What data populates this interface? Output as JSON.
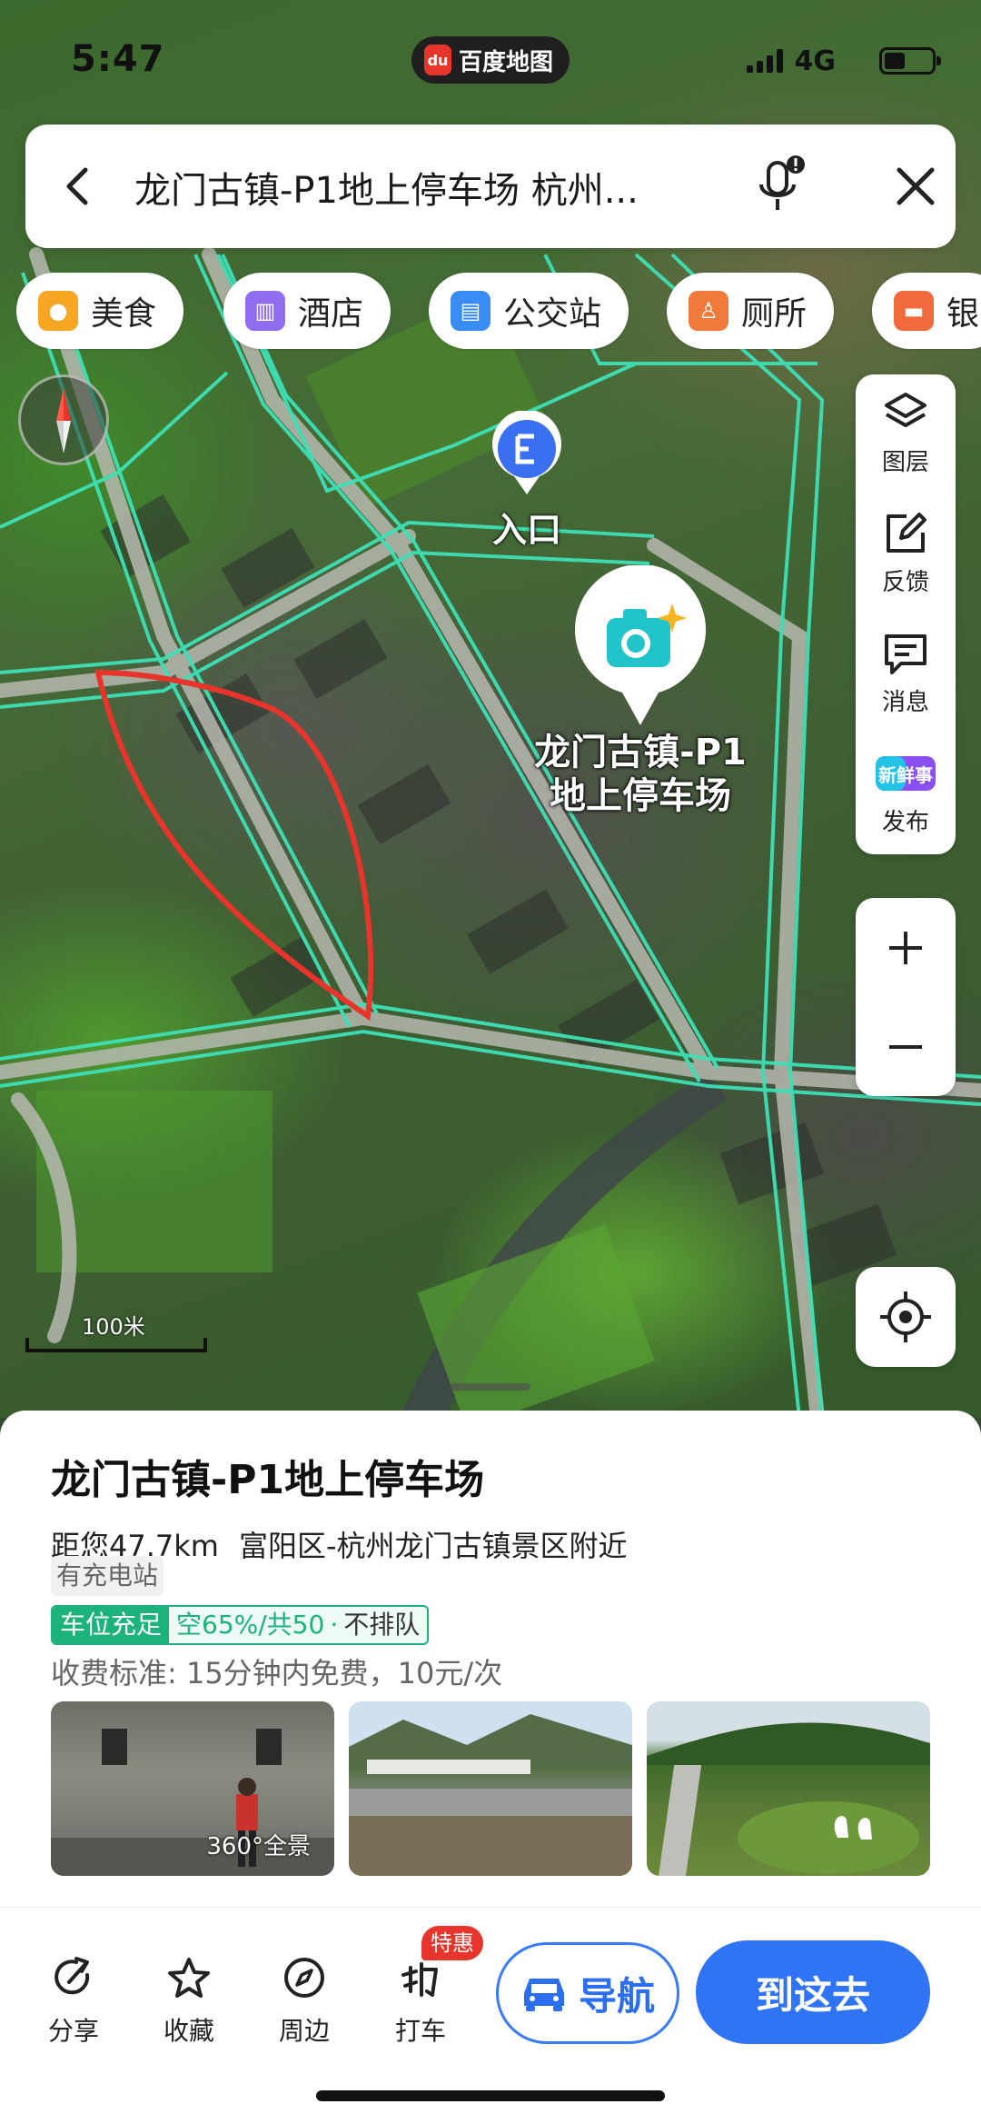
{
  "status_bar": {
    "time": "5:47",
    "app_logo": "百度地图",
    "network": "4G"
  },
  "search": {
    "query": "龙门古镇-P1地上停车场 杭州..."
  },
  "categories": [
    {
      "label": "美食",
      "icon": "food-icon",
      "color": "#f6a623"
    },
    {
      "label": "酒店",
      "icon": "hotel-icon",
      "color": "#8f6cf0"
    },
    {
      "label": "公交站",
      "icon": "bus-stop-icon",
      "color": "#3a8cf5"
    },
    {
      "label": "厕所",
      "icon": "toilet-icon",
      "color": "#f07a3c"
    },
    {
      "label": "银",
      "icon": "bank-icon",
      "color": "#f06a3c"
    }
  ],
  "tools": [
    {
      "label": "图层",
      "icon": "layers-icon"
    },
    {
      "label": "反馈",
      "icon": "feedback-icon"
    },
    {
      "label": "消息",
      "icon": "message-icon"
    },
    {
      "label": "发布",
      "icon": "xinxianshi-icon",
      "sub": "新鲜事"
    }
  ],
  "map": {
    "entrance_label": "入口",
    "place_label_line1": "龙门古镇-P1",
    "place_label_line2": "地上停车场",
    "scale": "100米"
  },
  "place": {
    "title": "龙门古镇-P1地上停车场",
    "distance": "距您47.7km",
    "address": "富阳区-杭州龙门古镇景区附近",
    "tag": "有充电站",
    "parking_status": "车位充足",
    "parking_detail": "空65%/共50",
    "queue": "不排队",
    "fee": "收费标准: 15分钟内免费，10元/次",
    "photo_360_label": "360°全景"
  },
  "actions": [
    {
      "label": "分享",
      "icon": "share-icon"
    },
    {
      "label": "收藏",
      "icon": "star-icon"
    },
    {
      "label": "周边",
      "icon": "compass-icon"
    },
    {
      "label": "打车",
      "icon": "taxi-icon"
    }
  ],
  "taxi_badge": "特惠",
  "nav_button": "导航",
  "go_button": "到这去",
  "colors": {
    "accent": "#2f74f4",
    "road": "#3fe0b6",
    "parking_green": "#1cb27c",
    "route_red": "#e8342a"
  }
}
